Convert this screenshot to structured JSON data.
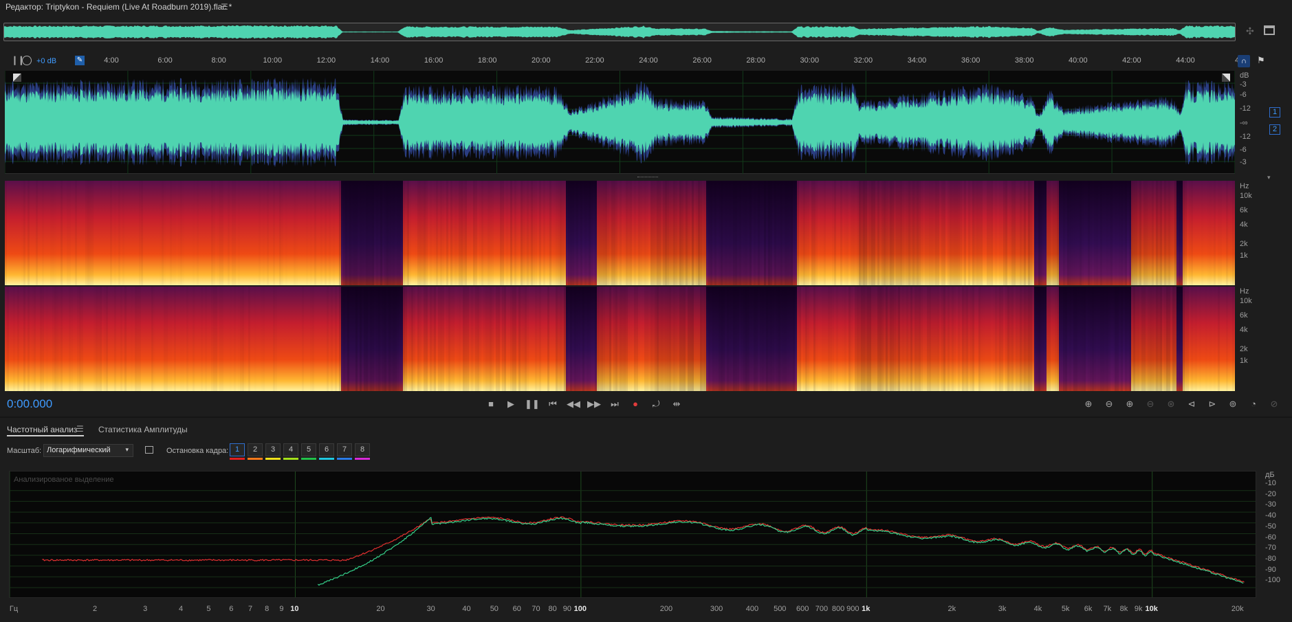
{
  "window": {
    "title": "Редактор: Triptykon - Requiem (Live At Roadburn 2019).flac *",
    "menu_icon": "hamburger-icon"
  },
  "ruler": {
    "labels": [
      "4:00",
      "6:00",
      "8:00",
      "10:00",
      "12:00",
      "14:00",
      "16:00",
      "18:00",
      "20:00",
      "22:00",
      "24:00",
      "26:00",
      "28:00",
      "30:00",
      "32:00",
      "34:00",
      "36:00",
      "38:00",
      "40:00",
      "42:00",
      "44:00",
      "46"
    ],
    "level_label": "+0 dB"
  },
  "waveform": {
    "db_labels": [
      "dB",
      "-3",
      "-6",
      "-12",
      "-∞",
      "-12",
      "-6",
      "-3"
    ],
    "channel_badges": [
      "1",
      "2"
    ],
    "color": "#4fd4b0"
  },
  "spectral": {
    "hz_labels": [
      "Hz",
      "10k",
      "6k",
      "4k",
      "2k",
      "1k"
    ]
  },
  "transport": {
    "time": "0:00.000",
    "buttons": [
      "stop",
      "play",
      "pause",
      "go-to-start",
      "rewind",
      "fast-forward",
      "go-to-end",
      "record",
      "loop",
      "skip-selection"
    ],
    "record_color": "#e23b3b"
  },
  "panel": {
    "tabs": [
      "Частотный анализ",
      "Статистика Амплитуды"
    ],
    "scale_label": "Масштаб:",
    "scale_value": "Логарифмический",
    "freeze_label": "Остановка кадра:",
    "frames": [
      "1",
      "2",
      "3",
      "4",
      "5",
      "6",
      "7",
      "8"
    ],
    "frame_colors": [
      "#e02020",
      "#ff7a1a",
      "#f5e21a",
      "#a4e01a",
      "#22c24a",
      "#20c8e0",
      "#2a7be8",
      "#d82ad8"
    ]
  },
  "analysis": {
    "watermark": "Анализированое выделение",
    "y_labels": [
      "дБ",
      "-10",
      "-20",
      "-30",
      "-40",
      "-50",
      "-60",
      "-70",
      "-80",
      "-90",
      "-100"
    ],
    "x_labels": [
      "Гц",
      "2",
      "3",
      "4",
      "5",
      "6",
      "7",
      "8",
      "9",
      "10",
      "20",
      "30",
      "40",
      "50",
      "60",
      "70",
      "80",
      "90",
      "100",
      "200",
      "300",
      "400",
      "500",
      "600",
      "700",
      "800",
      "900",
      "1k",
      "2k",
      "3k",
      "4k",
      "5k",
      "6k",
      "7k",
      "8k",
      "9k",
      "10k",
      "20k"
    ],
    "x_bold": [
      "10",
      "100",
      "1k",
      "10k"
    ],
    "series": [
      {
        "color": "#e23030"
      },
      {
        "color": "#35d08a"
      }
    ]
  }
}
